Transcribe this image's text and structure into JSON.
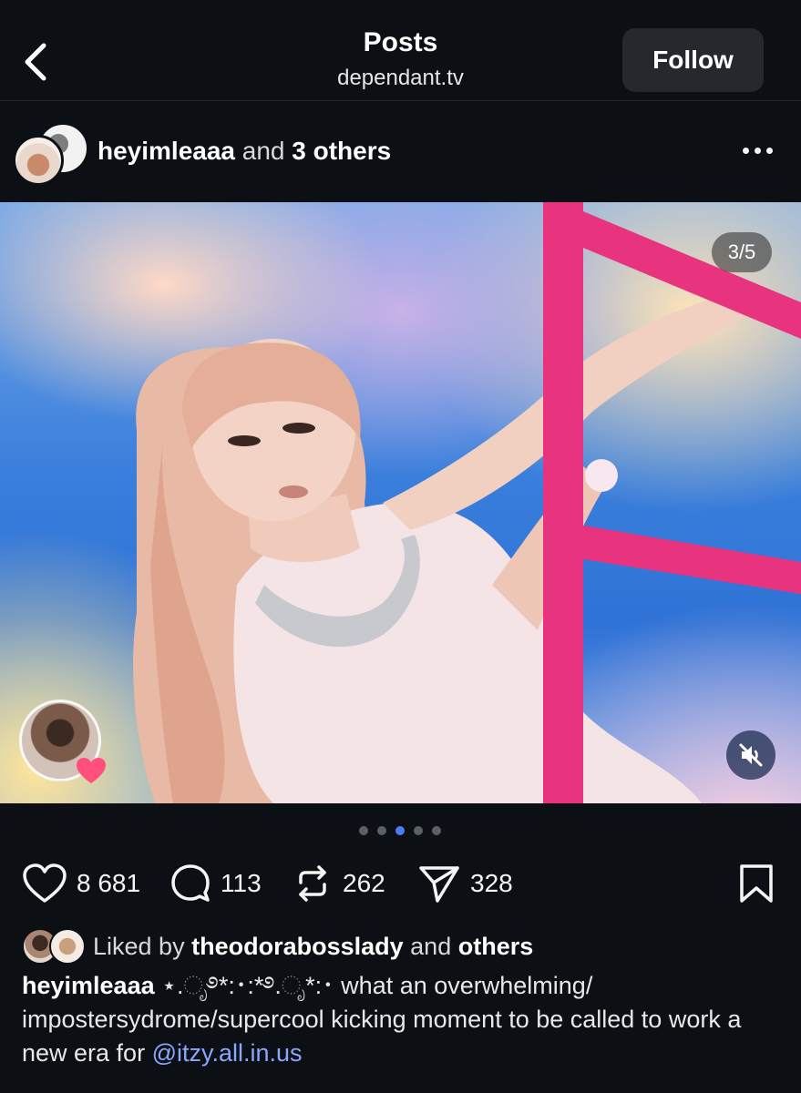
{
  "header": {
    "title": "Posts",
    "subtitle": "dependant.tv",
    "follow_label": "Follow"
  },
  "post": {
    "author": "heyimleaaa",
    "and_text": "and",
    "others_label": "3 others",
    "image_counter": "3/5",
    "carousel": {
      "total": 5,
      "active_index": 2
    }
  },
  "actions": {
    "likes": "8 681",
    "comments": "113",
    "reposts": "262",
    "shares": "328"
  },
  "liked_by": {
    "prefix": "Liked by",
    "user": "theodorabosslady",
    "and_text": "and",
    "others": "others"
  },
  "caption": {
    "username": "heyimleaaa",
    "text": "⋆.ೃ࿔*:･:*࿔.ೃ*:･ what an overwhelming/ impostersydrome/supercool kicking moment to be called to work a new era for",
    "mention": "@itzy.all.in.us"
  },
  "icons": {
    "back": "chevron-left-icon",
    "more": "more-horizontal-icon",
    "like": "heart-icon",
    "comment": "comment-icon",
    "repost": "repost-icon",
    "share": "send-icon",
    "save": "bookmark-icon",
    "mute": "muted-speaker-icon"
  },
  "colors": {
    "background": "#0c1014",
    "accent_dot": "#4f7cf3",
    "mention": "#8aa6ff",
    "ladder": "#e8337f"
  }
}
